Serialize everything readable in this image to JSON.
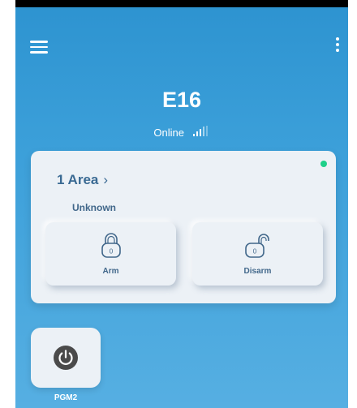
{
  "header": {
    "menu_icon": "hamburger-menu-icon",
    "more_icon": "vertical-dots-icon",
    "device_name": "E16",
    "connection_status": "Online",
    "signal_icon": "signal-bars-icon"
  },
  "area_card": {
    "title": "1 Area",
    "chevron": "›",
    "state": "Unknown",
    "status_dot_color": "#1ed08a",
    "arm_button": {
      "label": "Arm",
      "icon": "locked-padlock-icon",
      "badge": "0"
    },
    "disarm_button": {
      "label": "Disarm",
      "icon": "unlocked-padlock-icon",
      "badge": "0"
    }
  },
  "outputs": [
    {
      "label": "PGM2",
      "icon": "power-icon"
    }
  ],
  "colors": {
    "background_top": "#2d93d0",
    "background_bottom": "#56afe2",
    "card": "#ecf1f6",
    "accent_text": "#3a6a93"
  }
}
